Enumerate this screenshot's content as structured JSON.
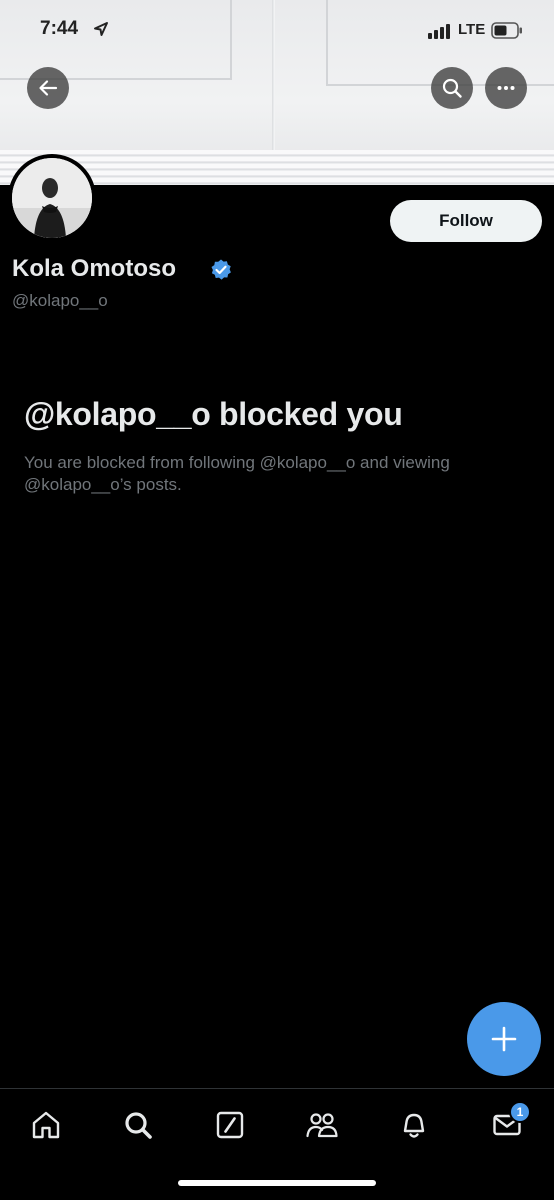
{
  "status_bar": {
    "time": "7:44",
    "network": "LTE"
  },
  "profile": {
    "display_name": "Kola Omotoso",
    "handle": "@kolapo__o",
    "verified": true,
    "follow_label": "Follow"
  },
  "blocked": {
    "title": "@kolapo__o blocked you",
    "description": "You are blocked from following @kolapo__o and viewing @kolapo__o’s posts."
  },
  "icons": {
    "back": "arrow-left-icon",
    "search": "search-icon",
    "more": "more-horizontal-icon",
    "verified": "verified-badge-icon",
    "compose": "plus-icon"
  },
  "bottom_nav": {
    "items": [
      {
        "name": "home",
        "icon": "home-icon"
      },
      {
        "name": "search",
        "icon": "search-icon"
      },
      {
        "name": "grok",
        "icon": "slash-box-icon"
      },
      {
        "name": "communities",
        "icon": "people-icon"
      },
      {
        "name": "notifications",
        "icon": "bell-icon"
      },
      {
        "name": "messages",
        "icon": "mail-icon"
      }
    ],
    "messages_badge": "1"
  },
  "colors": {
    "background": "#000000",
    "accent": "#4a99e9",
    "primary_text": "#e7e9ea",
    "secondary_text": "#71767b"
  }
}
